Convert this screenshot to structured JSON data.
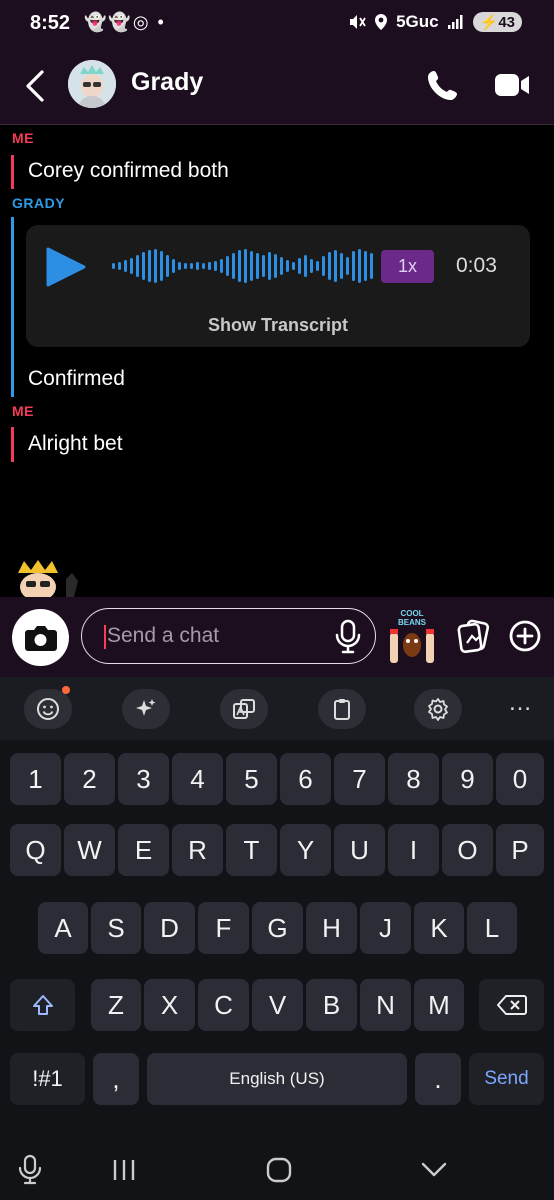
{
  "status_bar": {
    "time": "8:52",
    "left_icons": "👻👻◎ •",
    "network": "5Guc",
    "battery": "43"
  },
  "header": {
    "contact_name": "Grady"
  },
  "messages": [
    {
      "sender": "ME",
      "text": "Corey confirmed both"
    },
    {
      "sender": "GRADY",
      "text": "Confirmed"
    },
    {
      "sender": "ME",
      "text": "Alright bet"
    }
  ],
  "voice_note": {
    "speed": "1x",
    "duration": "0:03",
    "transcript_label": "Show Transcript"
  },
  "composer": {
    "placeholder": "Send a chat",
    "sticker_text": "COOL BEANS"
  },
  "keyboard": {
    "row_numbers": [
      "1",
      "2",
      "3",
      "4",
      "5",
      "6",
      "7",
      "8",
      "9",
      "0"
    ],
    "row_top": [
      "Q",
      "W",
      "E",
      "R",
      "T",
      "Y",
      "U",
      "I",
      "O",
      "P"
    ],
    "row_mid": [
      "A",
      "S",
      "D",
      "F",
      "G",
      "H",
      "J",
      "K",
      "L"
    ],
    "row_bottom": [
      "Z",
      "X",
      "C",
      "V",
      "B",
      "N",
      "M"
    ],
    "symbols_label": "!#1",
    "comma": ",",
    "space_label": "English (US)",
    "period": ".",
    "send_label": "Send",
    "more_label": "…"
  },
  "colors": {
    "me": "#f23c57",
    "grady": "#2f9ae6",
    "header_bg": "#1d0e1f",
    "speed_badge": "#6b2a8a"
  }
}
